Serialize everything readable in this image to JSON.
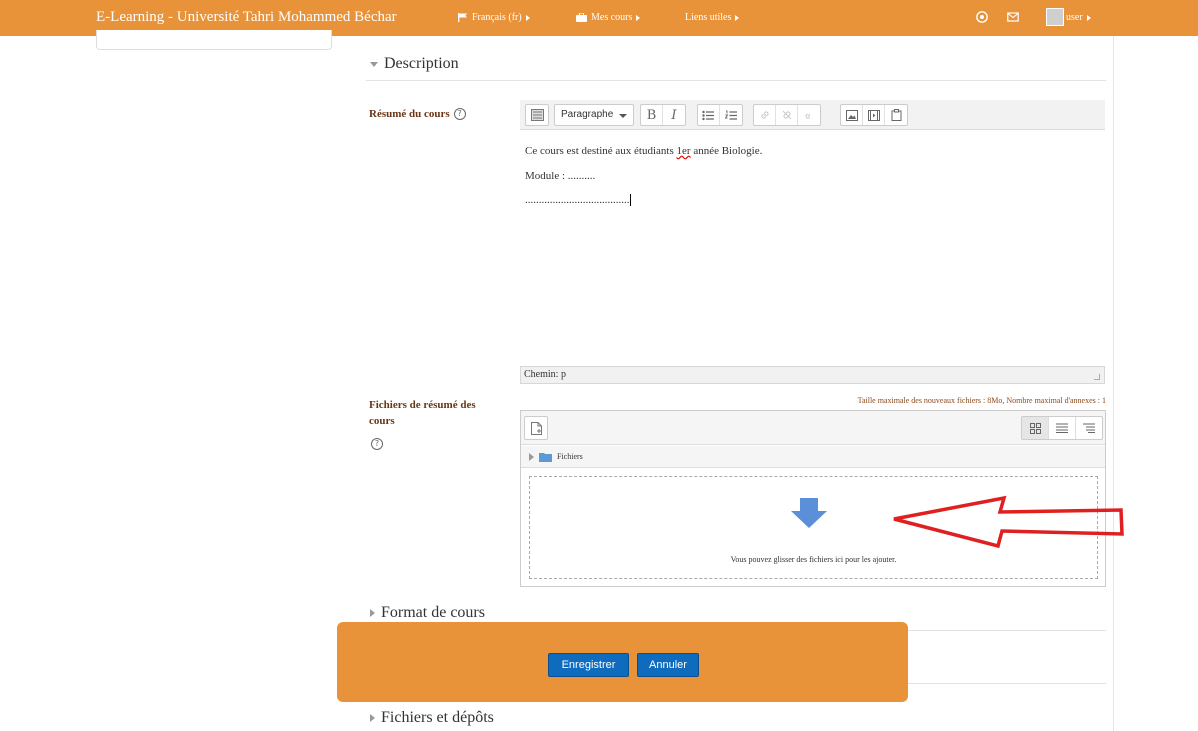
{
  "navbar": {
    "brand": "E-Learning - Université Tahri Mohammed Béchar",
    "language": "Français (fr)",
    "my_courses": "Mes cours",
    "useful_links": "Liens utiles",
    "user": "user",
    "color": "#e8923a"
  },
  "sections": {
    "description": "Description",
    "course_format": "Format de cours",
    "files_uploads": "Fichiers et dépôts"
  },
  "summary": {
    "label": "Résumé du cours",
    "format_select": "Paragraphe",
    "lines": {
      "l1_pre": "Ce cours est destiné aux étudiants ",
      "l1_err": "1er",
      "l1_post": " année Biologie.",
      "l2": "Module : ..........",
      "l3": "......................................"
    },
    "path": "Chemin: p"
  },
  "summary_files": {
    "label": "Fichiers de résumé des cours",
    "limits": "Taille maximale des nouveaux fichiers : 8Mo, Nombre maximal d'annexes : 1",
    "folder": "Fichiers",
    "drop_text": "Vous pouvez glisser des fichiers ici pour les ajouter."
  },
  "actions": {
    "save": "Enregistrer",
    "cancel": "Annuler"
  },
  "colors": {
    "accent": "#e8923a",
    "primary_button": "#0f6bbd",
    "label": "#6b3515",
    "annotation_arrow": "#e02020"
  }
}
